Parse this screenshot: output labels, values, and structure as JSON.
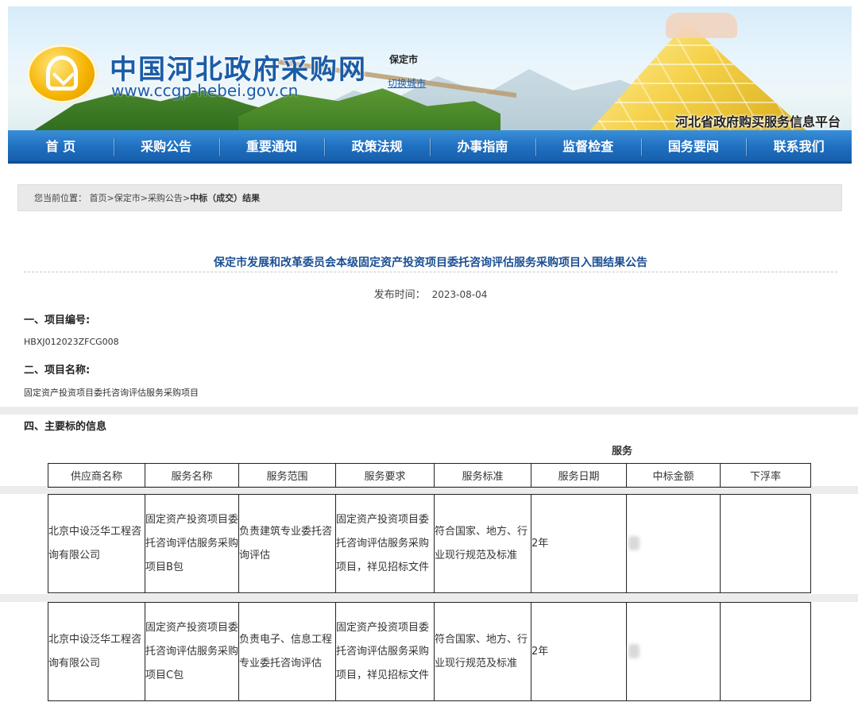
{
  "header": {
    "site_title": "中国河北政府采购网",
    "site_url": "www.ccgp-hebei.gov.cn",
    "city_name": "保定市",
    "city_switch": "切换城市",
    "platform_name": "河北省政府购买服务信息平台"
  },
  "nav": {
    "items": [
      {
        "label": "首 页"
      },
      {
        "label": "采购公告"
      },
      {
        "label": "重要通知"
      },
      {
        "label": "政策法规"
      },
      {
        "label": "办事指南"
      },
      {
        "label": "监督检查"
      },
      {
        "label": "国务要闻"
      },
      {
        "label": "联系我们"
      }
    ]
  },
  "breadcrumb": {
    "prefix": "您当前位置：",
    "items": [
      {
        "label": "首页"
      },
      {
        "label": "保定市"
      },
      {
        "label": "采购公告"
      },
      {
        "label": "中标（成交）结果"
      }
    ],
    "separator": ">"
  },
  "article": {
    "title": "保定市发展和改革委员会本级固定资产投资项目委托咨询评估服务采购项目入围结果公告",
    "publish_label": "发布时间：",
    "publish_date": "2023-08-04",
    "sections": {
      "project_no_heading": "一、项目编号:",
      "project_no_value": "HBXJ012023ZFCG008",
      "project_name_heading": "二、项目名称:",
      "project_name_value": "固定资产投资项目委托咨询评估服务采购项目",
      "main_bid_heading": "四、主要标的信息"
    }
  },
  "table": {
    "group_header": "服务",
    "columns": [
      "供应商名称",
      "服务名称",
      "服务范围",
      "服务要求",
      "服务标准",
      "服务日期",
      "中标金额",
      "下浮率"
    ],
    "rows": [
      {
        "supplier": "北京中设泛华工程咨询有限公司",
        "service_name": "固定资产投资项目委托咨询评估服务采购项目B包",
        "scope": "负责建筑专业委托咨询评估",
        "requirement": "固定资产投资项目委托咨询评估服务采购项目，祥见招标文件",
        "standard": "符合国家、地方、行业现行规范及标准",
        "period": "2年",
        "amount": "",
        "rate": ""
      },
      {
        "supplier": "北京中设泛华工程咨询有限公司",
        "service_name": "固定资产投资项目委托咨询评估服务采购项目C包",
        "scope": "负责电子、信息工程专业委托咨询评估",
        "requirement": "固定资产投资项目委托咨询评估服务采购项目，祥见招标文件",
        "standard": "符合国家、地方、行业现行规范及标准",
        "period": "2年",
        "amount": "",
        "rate": ""
      }
    ]
  },
  "colors": {
    "nav_blue": "#1f6fc0",
    "title_blue": "#1b4f93",
    "logo_gold": "#f5b400"
  }
}
